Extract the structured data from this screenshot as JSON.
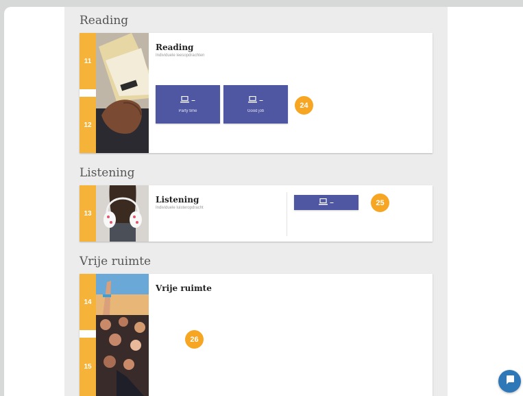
{
  "sections": [
    {
      "heading": "Reading",
      "card_title": "Reading",
      "card_subtitle": "Individuele leesopdrachten",
      "numbers": [
        "11",
        "12"
      ],
      "tiles": [
        {
          "icon": "laptop-icon",
          "dash": "–",
          "label": "Party time"
        },
        {
          "icon": "laptop-icon",
          "dash": "–",
          "label": "Good job"
        }
      ],
      "marker": "24"
    },
    {
      "heading": "Listening",
      "card_title": "Listening",
      "card_subtitle": "Individuele luisteropdracht",
      "numbers": [
        "13"
      ],
      "tiles": [
        {
          "icon": "laptop-icon",
          "dash": "–",
          "label": ""
        }
      ],
      "marker": "25"
    },
    {
      "heading": "Vrije ruimte",
      "card_title": "Vrije ruimte",
      "card_subtitle": "",
      "numbers": [
        "14",
        "15"
      ],
      "tiles": [],
      "marker": "26"
    }
  ],
  "chat_button": {
    "icon": "chat-bubble-icon"
  },
  "colors": {
    "accent_yellow": "#f6b33a",
    "tile_blue": "#4f57a3",
    "marker_orange": "#f6a623",
    "chat_blue": "#2e78b7"
  }
}
